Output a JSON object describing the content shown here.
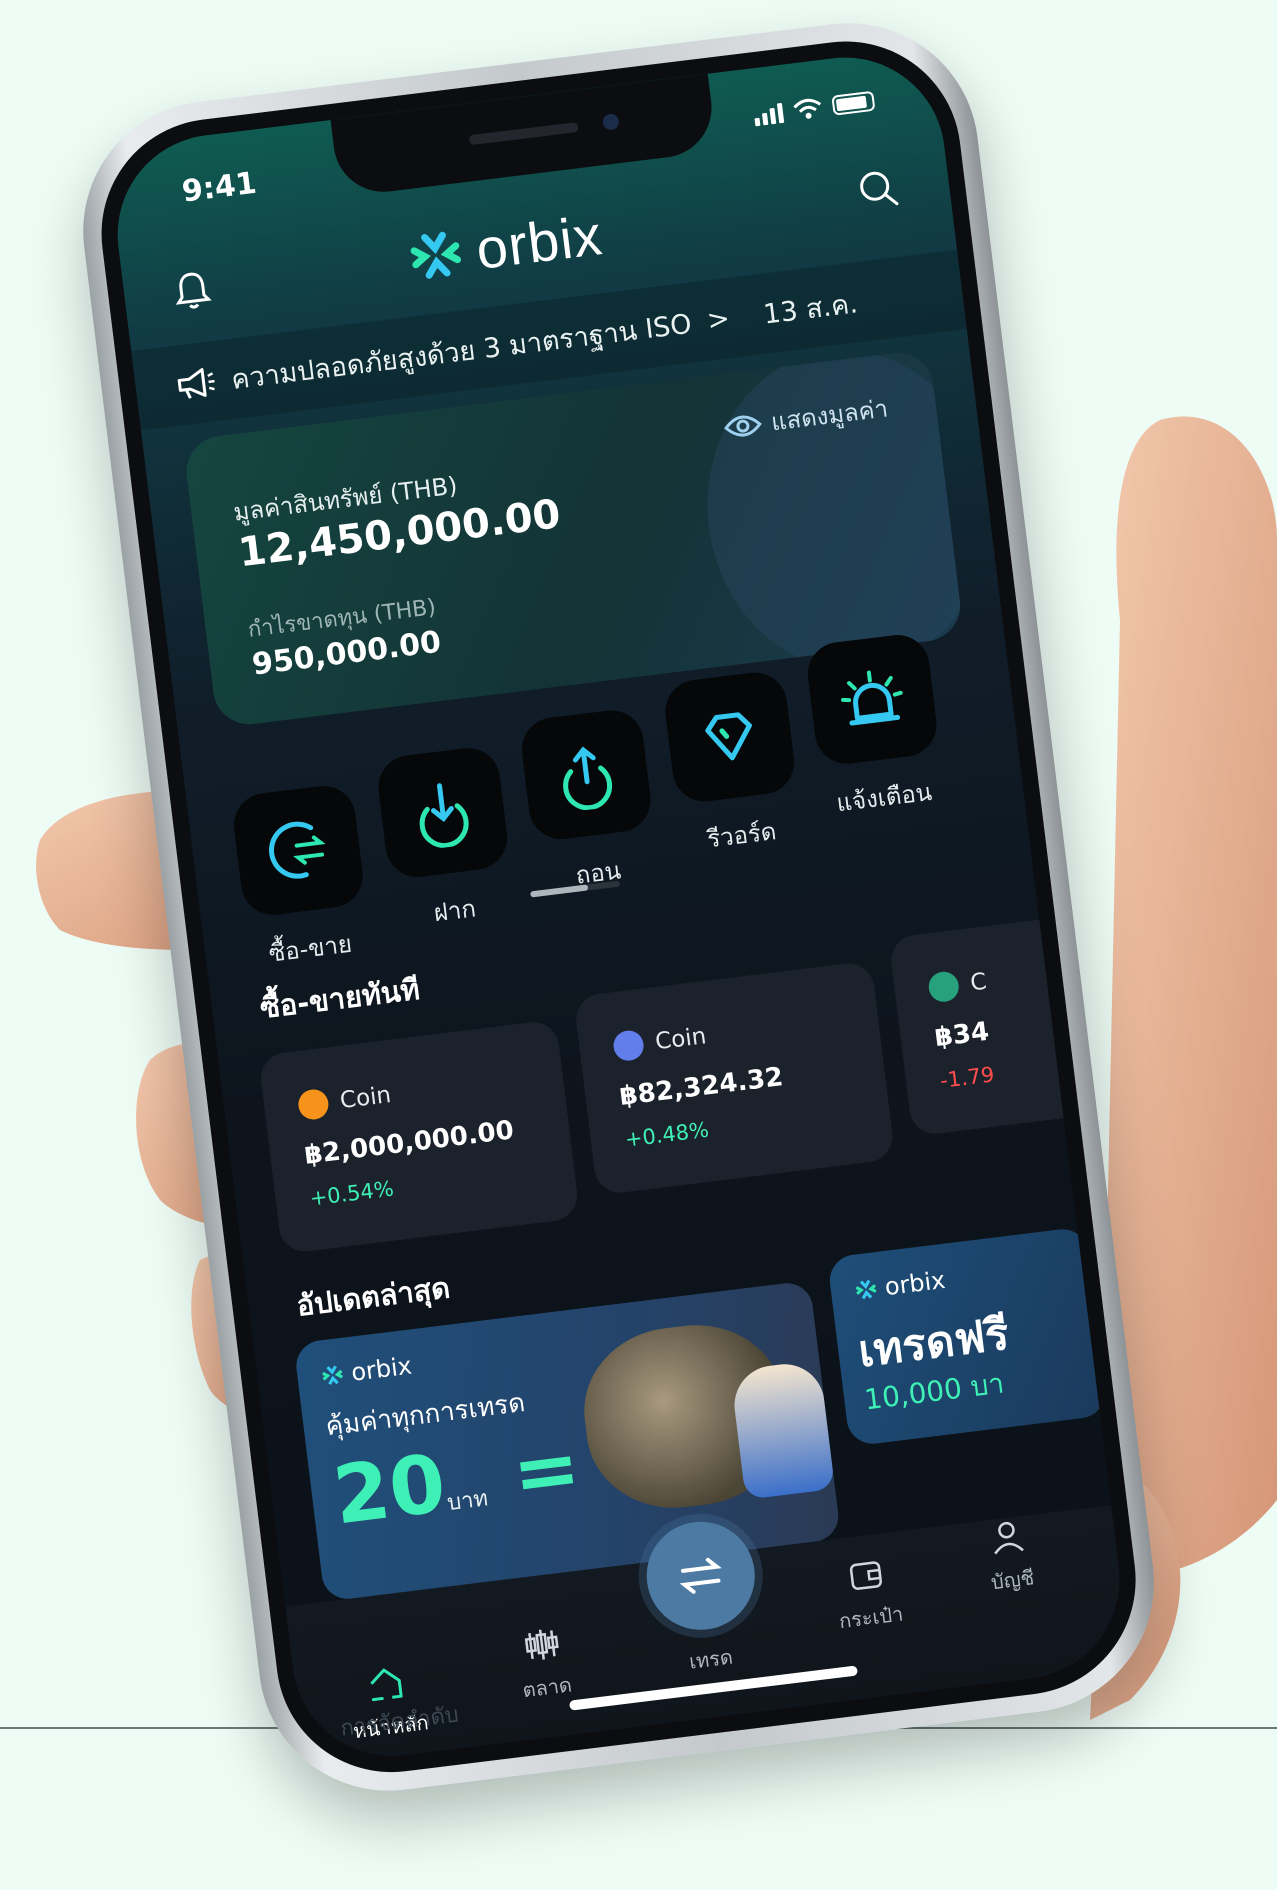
{
  "status": {
    "time": "9:41"
  },
  "app": {
    "name": "orbix"
  },
  "banner": {
    "text": "ความปลอดภัยสูงด้วย 3 มาตราฐาน ISO",
    "arrow": ">",
    "date": "13 ส.ค."
  },
  "assets": {
    "show_value_label": "แสดงมูลค่า",
    "value_label": "มูลค่าสินทรัพย์ (THB)",
    "value": "12,450,000.00",
    "pl_label": "กำไรขาดทุน (THB)",
    "pl_value": "950,000.00"
  },
  "actions": [
    {
      "label": "ซื้อ-ขาย",
      "icon": "buy-sell-icon"
    },
    {
      "label": "ฝาก",
      "icon": "deposit-icon"
    },
    {
      "label": "ถอน",
      "icon": "withdraw-icon"
    },
    {
      "label": "รีวอร์ด",
      "icon": "reward-diamond-icon"
    },
    {
      "label": "แจ้งเตือน",
      "icon": "alarm-icon"
    }
  ],
  "quick_trade": {
    "title": "ซื้อ-ขายทันที",
    "coins": [
      {
        "name": "Coin",
        "price": "฿2,000,000.00",
        "change": "+0.54%",
        "color": "#f7931a"
      },
      {
        "name": "Coin",
        "price": "฿82,324.32",
        "change": "+0.48%",
        "color": "#627eea"
      },
      {
        "name": "C",
        "price": "฿34",
        "change": "-1.79",
        "color": "#26a17b"
      }
    ]
  },
  "updates": {
    "title": "อัปเดตล่าสุด",
    "promo1": {
      "logo": "orbix",
      "title": "คุ้มค่าทุกการเทรด",
      "big": "20",
      "unit": "บาท",
      "equals": "= 1"
    },
    "promo2": {
      "logo": "orbix",
      "title": "เทรดฟรี",
      "sub": "10,000 บา"
    }
  },
  "bottom_nav": {
    "home": "หน้าหลัก",
    "market": "ตลาด",
    "trade": "เทรด",
    "wallet": "กระเป๋า",
    "account": "บัญชี",
    "ranking": "การจัดลำดับ"
  },
  "colors": {
    "positive": "#3ff0b6",
    "negative": "#ff4d4f",
    "accent": "#1fd1a0"
  }
}
